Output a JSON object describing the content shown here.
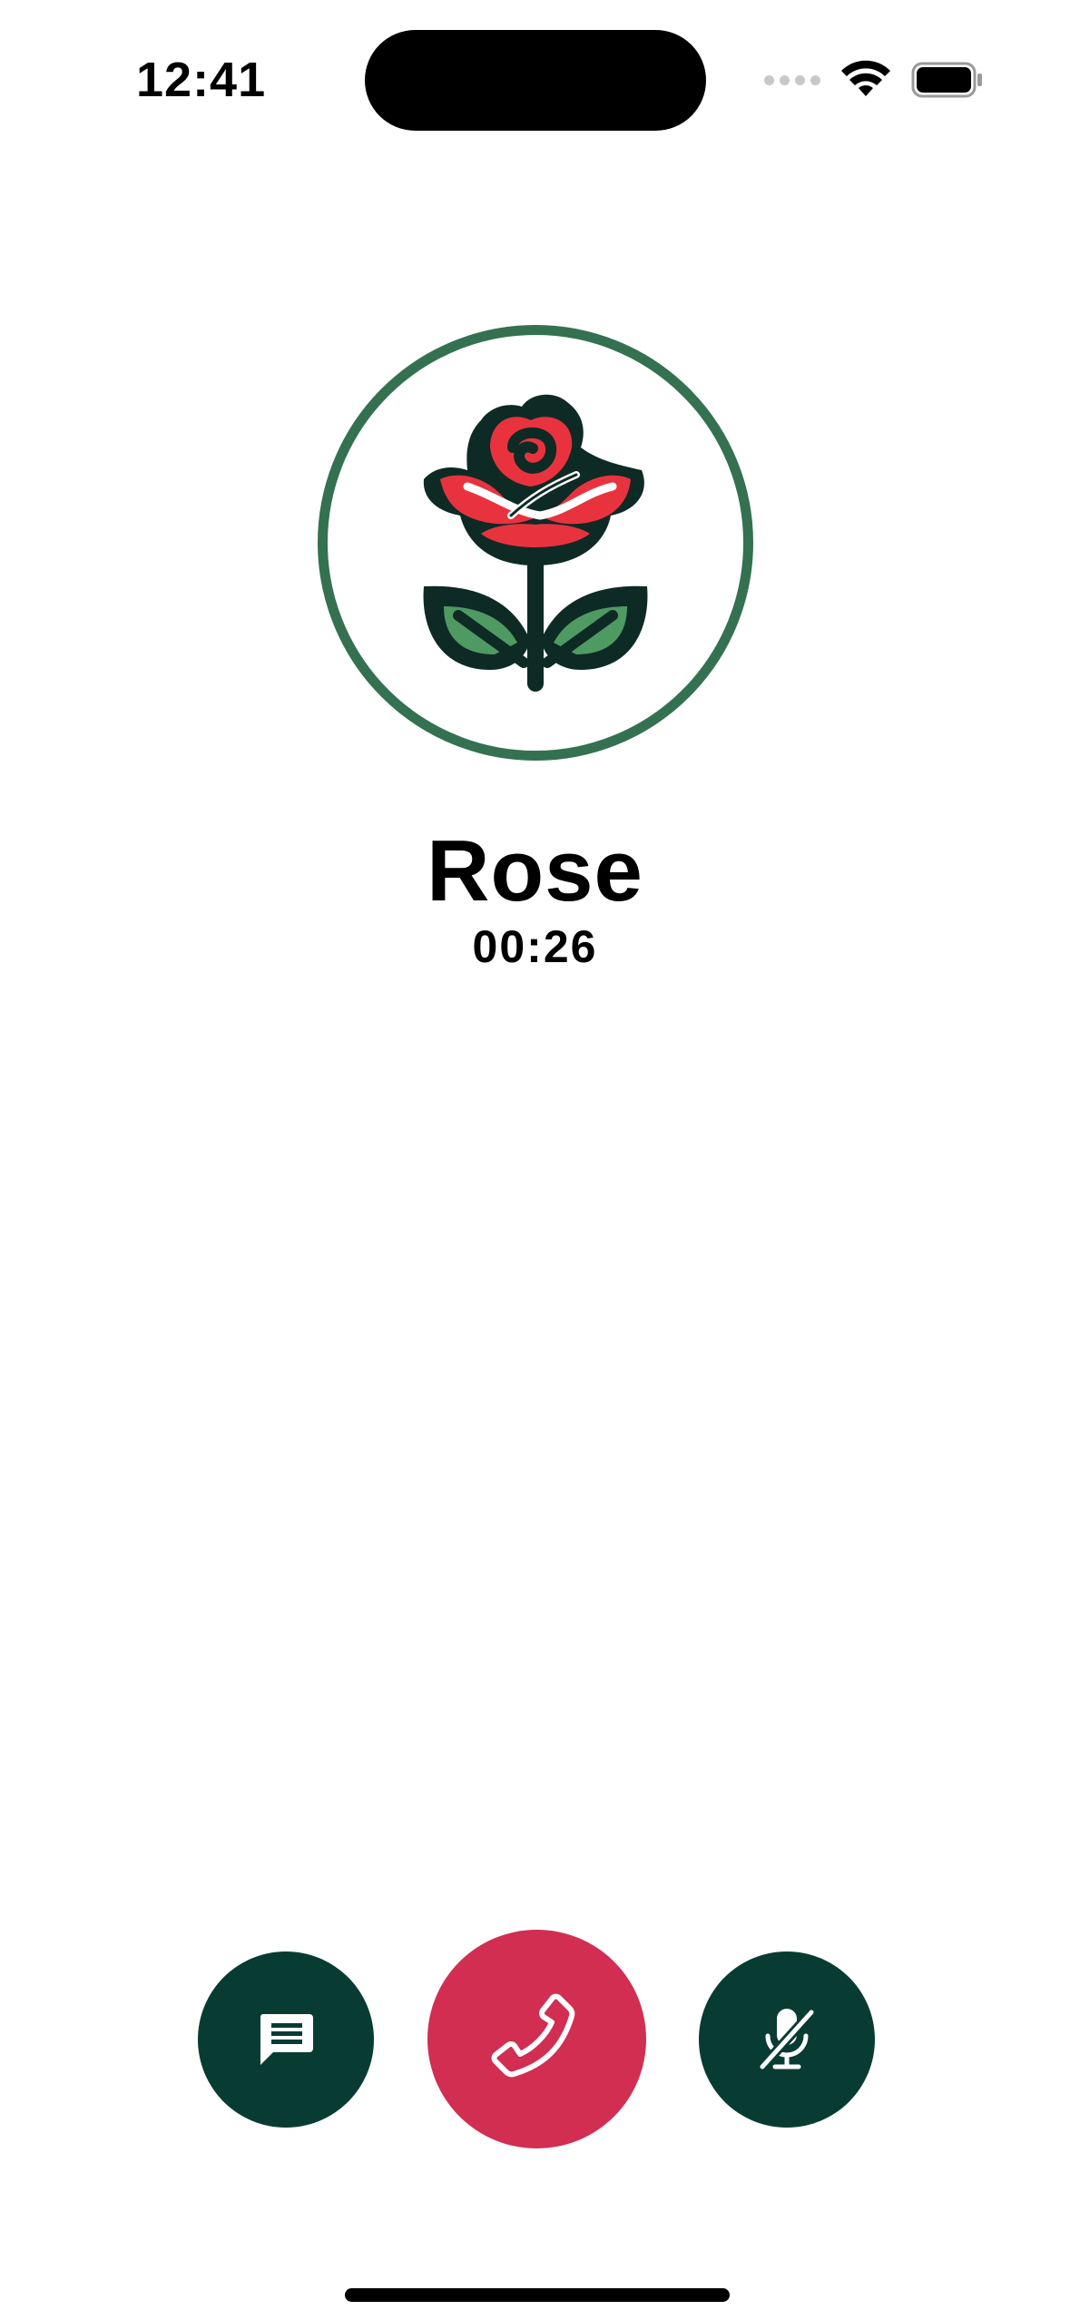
{
  "status_bar": {
    "time": "12:41",
    "icons": [
      "cellular-signal-icon",
      "wifi-icon",
      "battery-icon"
    ]
  },
  "call": {
    "caller_name": "Rose",
    "duration": "00:26",
    "avatar_icon": "rose-icon"
  },
  "controls": [
    {
      "name": "message-button",
      "icon": "message-icon"
    },
    {
      "name": "end-call-button",
      "icon": "phone-hangup-icon"
    },
    {
      "name": "mute-button",
      "icon": "mic-off-icon"
    }
  ],
  "colors": {
    "ring": "#347150",
    "control_dark": "#083c33",
    "end_call": "#d12e52",
    "rose_red": "#e8333f",
    "leaf_green": "#4e9a62"
  }
}
